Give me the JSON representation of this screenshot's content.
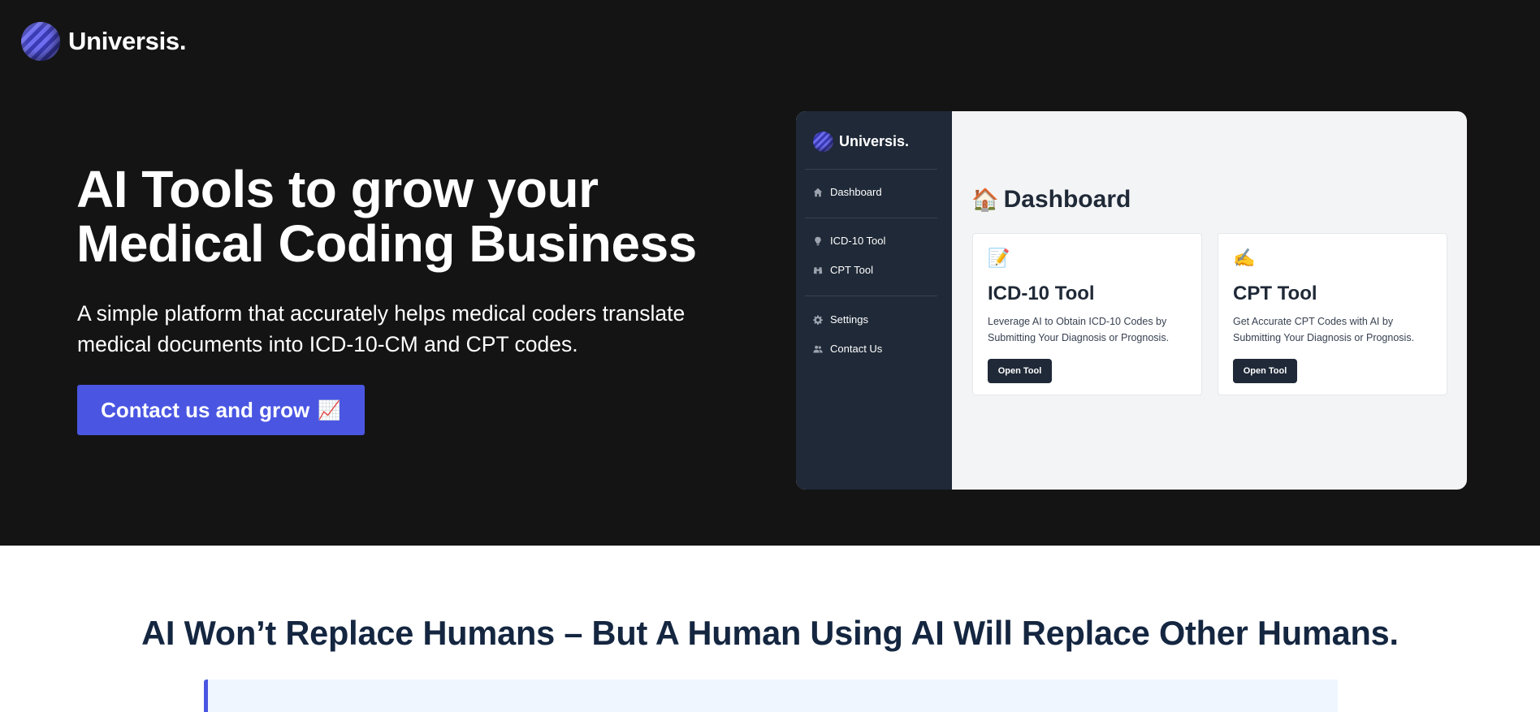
{
  "brand": {
    "name": "Universis."
  },
  "hero": {
    "headline_line1": "AI Tools to grow your",
    "headline_line2": "Medical Coding Business",
    "subhead_line1": "A simple platform that accurately helps medical coders translate",
    "subhead_line2": "medical documents into ICD-10-CM and CPT codes.",
    "cta_label": "Contact us and grow",
    "cta_emoji": "📈"
  },
  "mockup": {
    "brand": "Universis.",
    "sidebar": {
      "items": [
        {
          "label": "Dashboard",
          "icon": "home-icon"
        },
        {
          "label": "ICD-10 Tool",
          "icon": "lightbulb-icon"
        },
        {
          "label": "CPT Tool",
          "icon": "binoculars-icon"
        },
        {
          "label": "Settings",
          "icon": "gear-icon"
        },
        {
          "label": "Contact Us",
          "icon": "users-icon"
        }
      ]
    },
    "dashboard_title": "Dashboard",
    "dashboard_emoji": "🏠",
    "cards": [
      {
        "emoji": "📝",
        "title": "ICD-10 Tool",
        "desc_line1": "Leverage AI to Obtain ICD-10 Codes by",
        "desc_line2": "Submitting Your Diagnosis or Prognosis.",
        "button": "Open Tool"
      },
      {
        "emoji": "✍️",
        "title": "CPT Tool",
        "desc_line1": "Get Accurate CPT Codes with AI by",
        "desc_line2": "Submitting Your Diagnosis or Prognosis.",
        "button": "Open Tool"
      }
    ]
  },
  "tagline": "AI Won’t Replace Humans – But A Human Using AI Will Replace Other Humans.",
  "colors": {
    "hero_bg": "#141414",
    "accent": "#4a56e2",
    "sidebar_bg": "#1f2937",
    "tagline": "#142640"
  }
}
